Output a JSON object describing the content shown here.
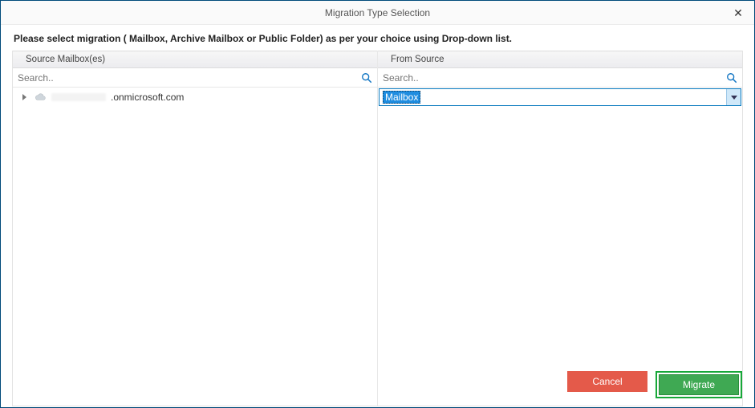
{
  "window": {
    "title": "Migration Type Selection",
    "close_label": "✕"
  },
  "instruction": "Please select migration ( Mailbox, Archive Mailbox or Public Folder) as per your choice using Drop-down list.",
  "left": {
    "header": "Source Mailbox(es)",
    "search_placeholder": "Search..",
    "tree_item_suffix": ".onmicrosoft.com"
  },
  "right": {
    "header": "From Source",
    "search_placeholder": "Search..",
    "combo_selected": "Mailbox"
  },
  "footer": {
    "cancel": "Cancel",
    "migrate": "Migrate"
  },
  "colors": {
    "accent_blue": "#0a7abf",
    "cancel_red": "#e45a4a",
    "migrate_green": "#3fa953",
    "migrate_frame": "#17a838"
  }
}
